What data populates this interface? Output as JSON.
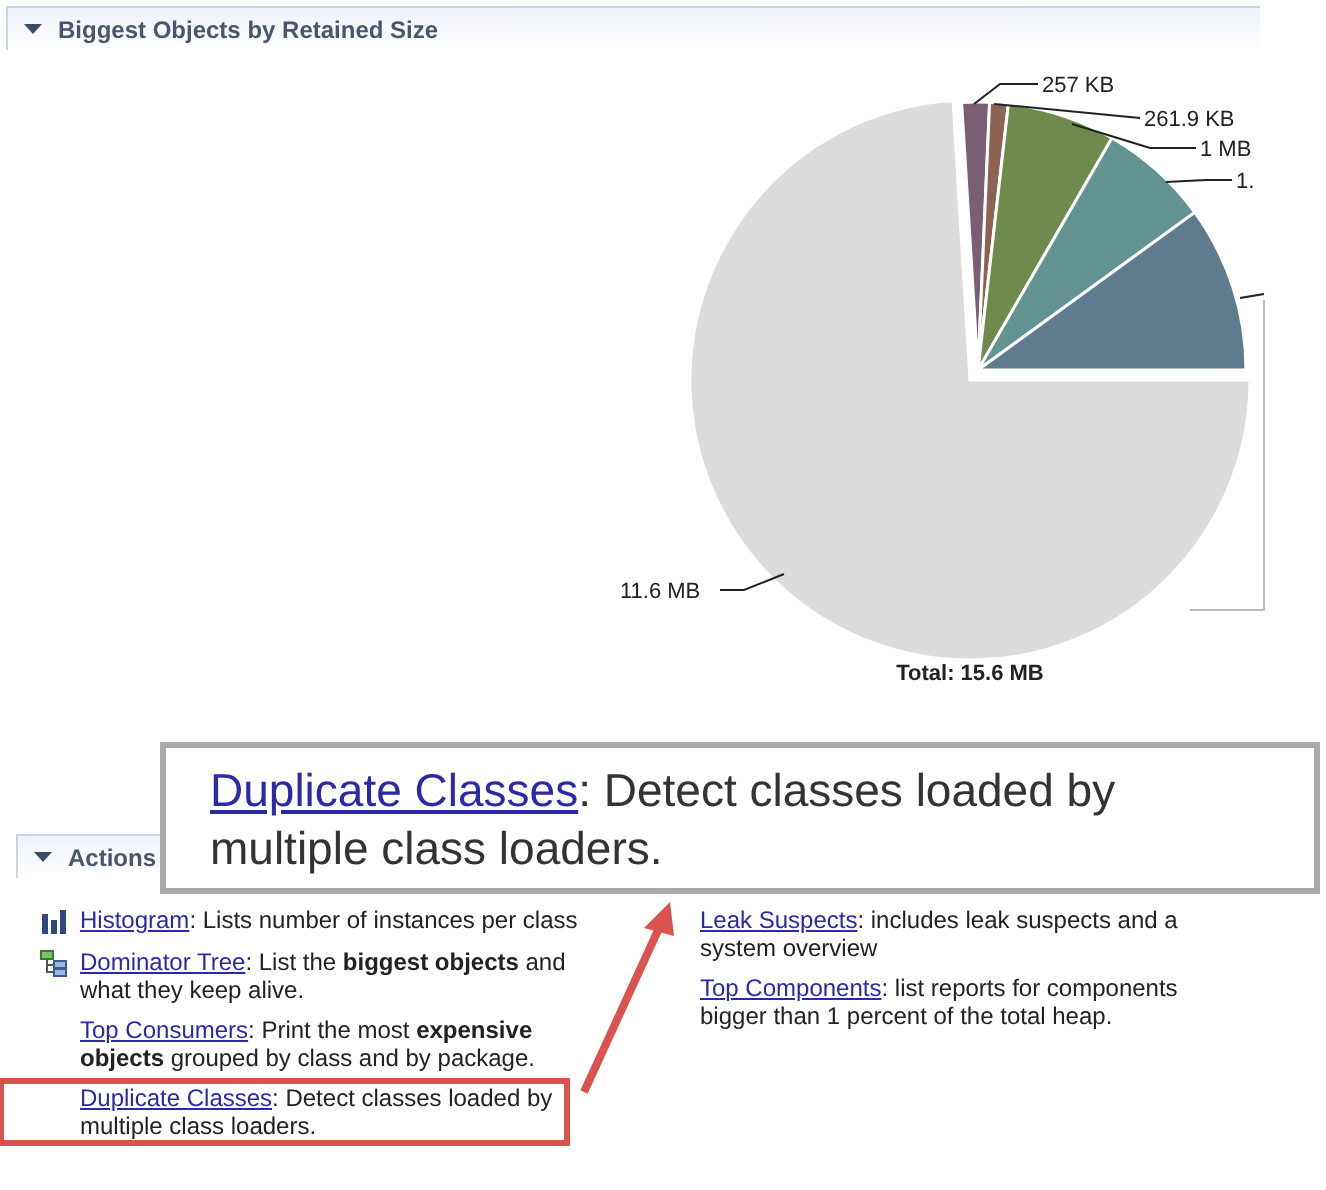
{
  "chart_panel": {
    "title": "Biggest Objects by Retained Size",
    "expanded": true,
    "slices": [
      {
        "label": "257 KB",
        "color": "#7a5f74"
      },
      {
        "label": "261.9 KB",
        "color": "#8c6352"
      },
      {
        "label": "1 MB",
        "color": "#6e8a4c"
      },
      {
        "label": "1.",
        "color": "#629390"
      },
      {
        "color": "#5f7c8e"
      },
      {
        "label": "11.6 MB",
        "color": "#dcdcdc"
      }
    ],
    "total": "Total: 15.6 MB"
  },
  "actions_panel": {
    "title": "Actions",
    "expanded": true,
    "columns": [
      [
        {
          "kind": "histogram",
          "link": "Histogram",
          "text": ": Lists number of instances per class",
          "highlighted": false
        },
        {
          "kind": "tree",
          "link": "Dominator Tree",
          "text": ": List the **biggest objects** and what they keep alive.",
          "highlighted": false
        },
        {
          "kind": "plain",
          "link": "Top Consumers",
          "text": ": Print the most **expensive objects** grouped by class and by package.",
          "highlighted": false
        },
        {
          "kind": "plain",
          "link": "Duplicate Classes",
          "text": ": Detect classes loaded by multiple class loaders.",
          "highlighted": true
        }
      ],
      [
        {
          "kind": "plain",
          "link": "Leak Suspects",
          "text": ": includes leak suspects and a system overview",
          "highlighted": false
        },
        {
          "kind": "plain",
          "link": "Top Components",
          "text": ": list reports for components bigger than 1 percent of the total heap.",
          "highlighted": false
        }
      ]
    ]
  },
  "callout": {
    "link": "Duplicate Classes",
    "text": ": Detect classes loaded by multiple class loaders."
  }
}
